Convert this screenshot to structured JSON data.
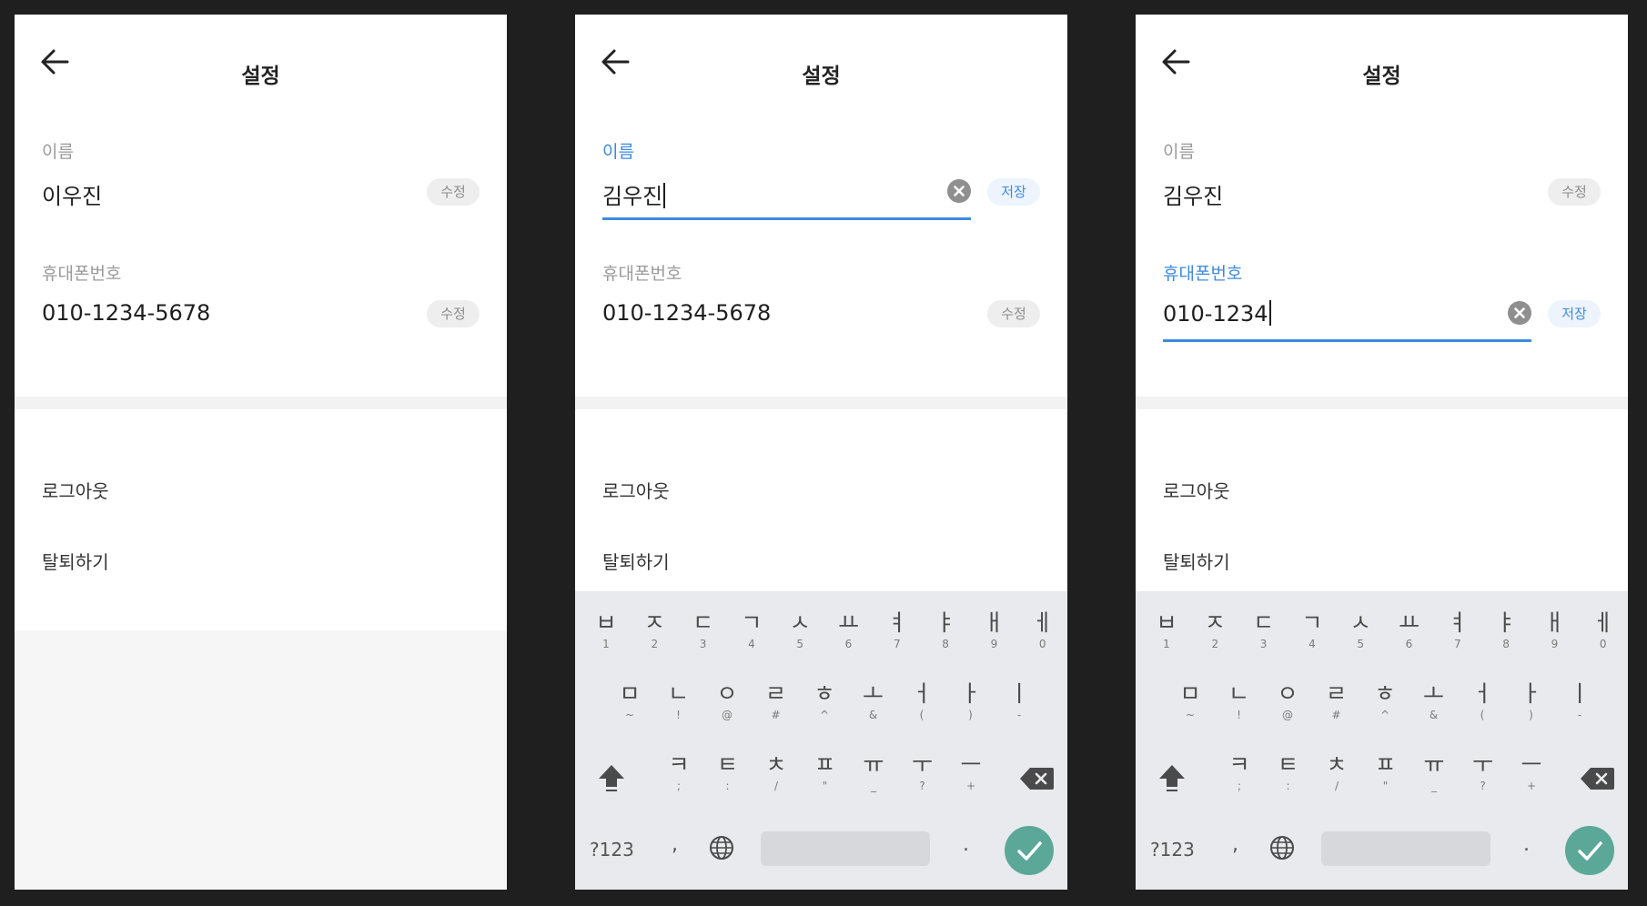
{
  "screens": [
    {
      "title": "설정",
      "name_field": {
        "label": "이름",
        "value": "이우진",
        "button": "수정"
      },
      "phone_field": {
        "label": "휴대폰번호",
        "value": "010-1234-5678",
        "button": "수정"
      },
      "menu": {
        "logout": "로그아웃",
        "withdraw": "탈퇴하기"
      }
    },
    {
      "title": "설정",
      "name_field": {
        "label": "이름",
        "value": "김우진",
        "button": "저장",
        "editing": true
      },
      "phone_field": {
        "label": "휴대폰번호",
        "value": "010-1234-5678",
        "button": "수정"
      },
      "menu": {
        "logout": "로그아웃",
        "withdraw": "탈퇴하기"
      }
    },
    {
      "title": "설정",
      "name_field": {
        "label": "이름",
        "value": "김우진",
        "button": "수정"
      },
      "phone_field": {
        "label": "휴대폰번호",
        "value": "010-1234",
        "button": "저장",
        "editing": true
      },
      "menu": {
        "logout": "로그아웃",
        "withdraw": "탈퇴하기"
      }
    }
  ],
  "keyboard": {
    "row1": [
      {
        "k": "ㅂ",
        "s": "1"
      },
      {
        "k": "ㅈ",
        "s": "2"
      },
      {
        "k": "ㄷ",
        "s": "3"
      },
      {
        "k": "ㄱ",
        "s": "4"
      },
      {
        "k": "ㅅ",
        "s": "5"
      },
      {
        "k": "ㅛ",
        "s": "6"
      },
      {
        "k": "ㅕ",
        "s": "7"
      },
      {
        "k": "ㅑ",
        "s": "8"
      },
      {
        "k": "ㅐ",
        "s": "9"
      },
      {
        "k": "ㅔ",
        "s": "0"
      }
    ],
    "row2": [
      {
        "k": "ㅁ",
        "s": "~"
      },
      {
        "k": "ㄴ",
        "s": "!"
      },
      {
        "k": "ㅇ",
        "s": "@"
      },
      {
        "k": "ㄹ",
        "s": "#"
      },
      {
        "k": "ㅎ",
        "s": "^"
      },
      {
        "k": "ㅗ",
        "s": "&"
      },
      {
        "k": "ㅓ",
        "s": "("
      },
      {
        "k": "ㅏ",
        "s": ")"
      },
      {
        "k": "ㅣ",
        "s": "-"
      }
    ],
    "row3": [
      {
        "k": "ㅋ",
        "s": ";"
      },
      {
        "k": "ㅌ",
        "s": ":"
      },
      {
        "k": "ㅊ",
        "s": "/"
      },
      {
        "k": "ㅍ",
        "s": "\""
      },
      {
        "k": "ㅠ",
        "s": "_"
      },
      {
        "k": "ㅜ",
        "s": "?"
      },
      {
        "k": "ㅡ",
        "s": "+"
      }
    ],
    "symbols_label": "?123",
    "comma": ",",
    "period": ".",
    "icons": [
      "shift-icon",
      "backspace-icon",
      "globe-icon",
      "checkmark-icon"
    ]
  },
  "colors": {
    "accent": "#3f8ae0",
    "done_button": "#5ba898",
    "background": "#1f1f1f"
  }
}
